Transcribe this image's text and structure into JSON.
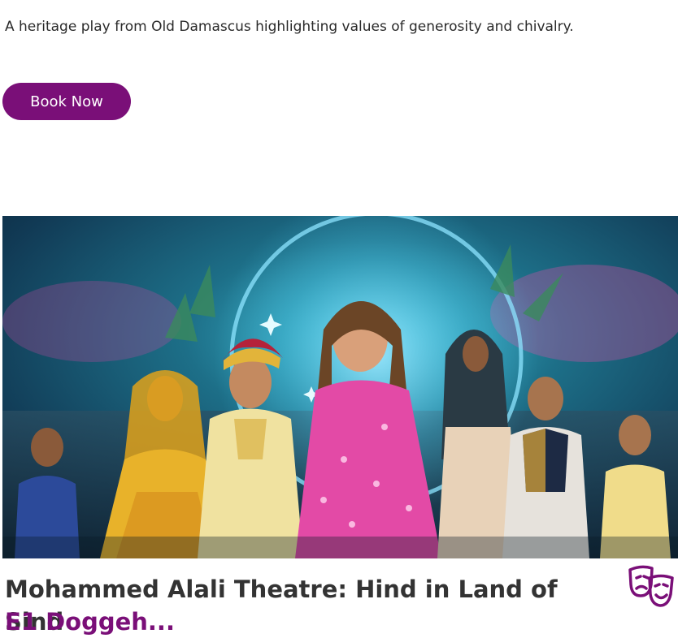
{
  "event": {
    "description": "A heritage play from Old Damascus highlighting values of generosity and chivalry.",
    "book_label": "Book Now",
    "title": "Mohammed Alali Theatre: Hind in Land of Sind",
    "subtitle": "E1 Doggeh..."
  },
  "poster": {
    "image": "theatre-poster-hind-in-land-of-sind"
  },
  "icons": {
    "category": "theatre-masks-icon"
  },
  "colors": {
    "brand": "#7a0f78",
    "title_text": "#333333"
  }
}
